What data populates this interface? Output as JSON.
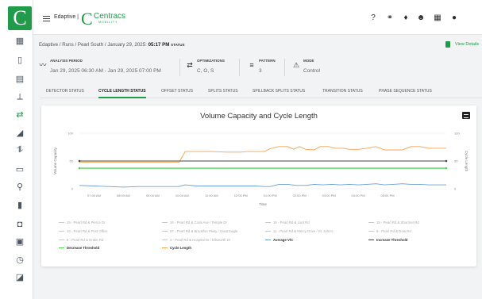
{
  "sidebar": {
    "logo": "C",
    "items": [
      {
        "icon": "grid-icon",
        "glyph": "▦"
      },
      {
        "icon": "map-icon",
        "glyph": "▯"
      },
      {
        "icon": "calendar-icon",
        "glyph": "▤"
      },
      {
        "icon": "route-icon",
        "glyph": "⟂"
      },
      {
        "icon": "swap-icon",
        "glyph": "⇄",
        "active": true
      },
      {
        "icon": "signal-icon",
        "glyph": "◢"
      },
      {
        "icon": "branch-icon",
        "glyph": "⥮"
      },
      {
        "icon": "bus-icon",
        "glyph": "▭"
      },
      {
        "icon": "satellite-icon",
        "glyph": "⚲"
      },
      {
        "icon": "bar-chart-icon",
        "glyph": "▮"
      },
      {
        "icon": "train-icon",
        "glyph": "◘"
      },
      {
        "icon": "image-icon",
        "glyph": "▣"
      },
      {
        "icon": "clock-icon",
        "glyph": "◷"
      },
      {
        "icon": "edit-icon",
        "glyph": "◪"
      }
    ]
  },
  "topbar": {
    "agency": "Edaptive |",
    "brand_name": "Centracs",
    "brand_sub": "MOBILITY",
    "icons": [
      {
        "icon": "help-icon",
        "glyph": "?"
      },
      {
        "icon": "network-icon",
        "glyph": "⚭"
      },
      {
        "icon": "bell-icon",
        "glyph": "♦"
      },
      {
        "icon": "user-icon",
        "glyph": "☻"
      },
      {
        "icon": "apps-icon",
        "glyph": "▦"
      },
      {
        "icon": "account-icon",
        "glyph": "●"
      }
    ]
  },
  "breadcrumb": {
    "path": "Edaptive / Runs / Pearl South / January 29, 2025:",
    "time": "05:17 PM",
    "status": "STATUS"
  },
  "view_details": "View Details",
  "meta": [
    {
      "icon": "analysis-icon",
      "glyph": "〰",
      "label": "ANALYSIS PERIOD",
      "value": "Jan 29, 2025 06:30 AM - Jan 29, 2025 07:00 PM"
    },
    {
      "icon": "optimizations-icon",
      "glyph": "⇄",
      "label": "OPTIMIZATIONS",
      "value": "C, O, S"
    },
    {
      "icon": "pattern-icon",
      "glyph": "≡",
      "label": "PATTERN",
      "value": "3"
    },
    {
      "icon": "mode-icon",
      "glyph": "⚠",
      "label": "MODE",
      "value": "Control"
    }
  ],
  "tabs": [
    {
      "label": "DETECTOR STATUS",
      "active": false
    },
    {
      "label": "CYCLE LENGTH STATUS",
      "active": true
    },
    {
      "label": "OFFSET STATUS",
      "active": false
    },
    {
      "label": "SPLITS STATUS",
      "active": false
    },
    {
      "label": "SPILLBACK SPLITS STATUS",
      "active": false
    },
    {
      "label": "TRANSITION STATUS",
      "active": false
    },
    {
      "label": "PHASE SEQUENCE STATUS",
      "active": false
    }
  ],
  "chart_data": {
    "type": "line",
    "title": "Volume Capacity and Cycle Length",
    "ylabel_left": "Volume Capacity",
    "ylabel_right": "Cycle Length",
    "xlabel": "Time",
    "x_ticks": [
      "07:00 AM",
      "08:00 AM",
      "09:00 AM",
      "10:00 AM",
      "11:00 AM",
      "12:00 PM",
      "01:00 PM",
      "02:00 PM",
      "03:00 PM",
      "04:00 PM",
      "05:00 PM"
    ],
    "y_left_ticks": [
      "100",
      "50",
      "0"
    ],
    "y_right_ticks": [
      "100",
      "50",
      "0"
    ],
    "ylim": [
      0,
      100
    ],
    "x_range_hours": [
      6.5,
      19.0
    ],
    "series": [
      {
        "name": "Cycle Length",
        "color": "#f5a352",
        "points": [
          [
            6.5,
            48
          ],
          [
            7.0,
            48
          ],
          [
            8.0,
            48
          ],
          [
            9.0,
            48
          ],
          [
            9.9,
            48
          ],
          [
            10.1,
            67
          ],
          [
            10.5,
            67
          ],
          [
            11.0,
            67
          ],
          [
            11.5,
            66
          ],
          [
            12.0,
            66
          ],
          [
            12.2,
            67
          ],
          [
            12.6,
            67
          ],
          [
            12.8,
            67
          ],
          [
            13.0,
            72
          ],
          [
            13.3,
            76
          ],
          [
            13.6,
            76
          ],
          [
            13.8,
            71
          ],
          [
            14.0,
            76
          ],
          [
            14.2,
            71
          ],
          [
            14.5,
            70
          ],
          [
            14.7,
            76
          ],
          [
            15.0,
            76
          ],
          [
            15.2,
            73
          ],
          [
            15.5,
            73
          ],
          [
            15.7,
            71
          ],
          [
            16.0,
            71
          ],
          [
            16.3,
            73
          ],
          [
            16.6,
            76
          ],
          [
            16.9,
            70
          ],
          [
            17.2,
            70
          ],
          [
            17.5,
            70
          ],
          [
            17.8,
            76
          ],
          [
            18.1,
            76
          ],
          [
            18.4,
            73
          ],
          [
            18.7,
            73
          ],
          [
            19.0,
            73
          ]
        ]
      },
      {
        "name": "Increase Threshold",
        "color": "#444444",
        "points": [
          [
            6.5,
            50
          ],
          [
            19.0,
            50
          ]
        ]
      },
      {
        "name": "Decrease Threshold",
        "color": "#55d655",
        "points": [
          [
            6.5,
            37
          ],
          [
            19.0,
            37
          ]
        ]
      },
      {
        "name": "Average V/C",
        "color": "#6b9ed8",
        "points": [
          [
            6.5,
            6
          ],
          [
            7.0,
            5
          ],
          [
            7.5,
            4
          ],
          [
            8.0,
            3
          ],
          [
            8.5,
            4
          ],
          [
            9.0,
            4
          ],
          [
            9.5,
            4
          ],
          [
            9.9,
            4
          ],
          [
            10.1,
            7
          ],
          [
            10.5,
            5
          ],
          [
            11.0,
            5
          ],
          [
            11.5,
            5
          ],
          [
            12.0,
            5
          ],
          [
            12.5,
            5
          ],
          [
            12.8,
            4
          ],
          [
            13.0,
            4
          ],
          [
            13.3,
            8
          ],
          [
            13.6,
            8
          ],
          [
            13.9,
            6
          ],
          [
            14.2,
            6
          ],
          [
            14.5,
            8
          ],
          [
            14.8,
            7
          ],
          [
            15.1,
            8
          ],
          [
            15.4,
            7
          ],
          [
            15.7,
            8
          ],
          [
            16.0,
            7
          ],
          [
            16.3,
            8
          ],
          [
            16.6,
            9
          ],
          [
            16.9,
            7
          ],
          [
            17.2,
            8
          ],
          [
            17.5,
            9
          ],
          [
            17.8,
            8
          ],
          [
            18.1,
            8
          ],
          [
            18.4,
            7
          ],
          [
            18.7,
            7
          ],
          [
            19.0,
            7
          ]
        ]
      }
    ],
    "legend": [
      {
        "name": "15 - Pearl Rd & Pierce Dr",
        "color": "#c8c8c8",
        "active": false
      },
      {
        "name": "16 - Pearl Rd & Cook Ave / Temple Dr",
        "color": "#c8c8c8",
        "active": false
      },
      {
        "name": "16 - Pearl Rd & Lunt Rd",
        "color": "#c8c8c8",
        "active": false
      },
      {
        "name": "15 - Pearl Rd & Shurmer Rd",
        "color": "#c8c8c8",
        "active": false
      },
      {
        "name": "13 - Pearl Rd & Post Office",
        "color": "#c8c8c8",
        "active": false
      },
      {
        "name": "57 - Pearl Rd & Brookfon Pkwy / Giant Eagle",
        "color": "#c8c8c8",
        "active": false
      },
      {
        "name": "11 - Pearl Rd & Mercy Drive / St. John's",
        "color": "#c8c8c8",
        "active": false
      },
      {
        "name": "8 - Pearl Rd & Dole Rd",
        "color": "#c8c8c8",
        "active": false
      },
      {
        "name": "5 - Pearl Rd & Drake Rd",
        "color": "#c8c8c8",
        "active": false
      },
      {
        "name": "4 - Pearl Rd & Hospital Dr / Ellsworth Dr",
        "color": "#c8c8c8",
        "active": false
      },
      {
        "name": "Average V/C",
        "color": "#6b9ed8",
        "active": true
      },
      {
        "name": "Increase Threshold",
        "color": "#444444",
        "active": true
      },
      {
        "name": "Decrease Threshold",
        "color": "#55d655",
        "active": true
      },
      {
        "name": "Cycle Length",
        "color": "#f5a352",
        "active": true
      }
    ]
  }
}
